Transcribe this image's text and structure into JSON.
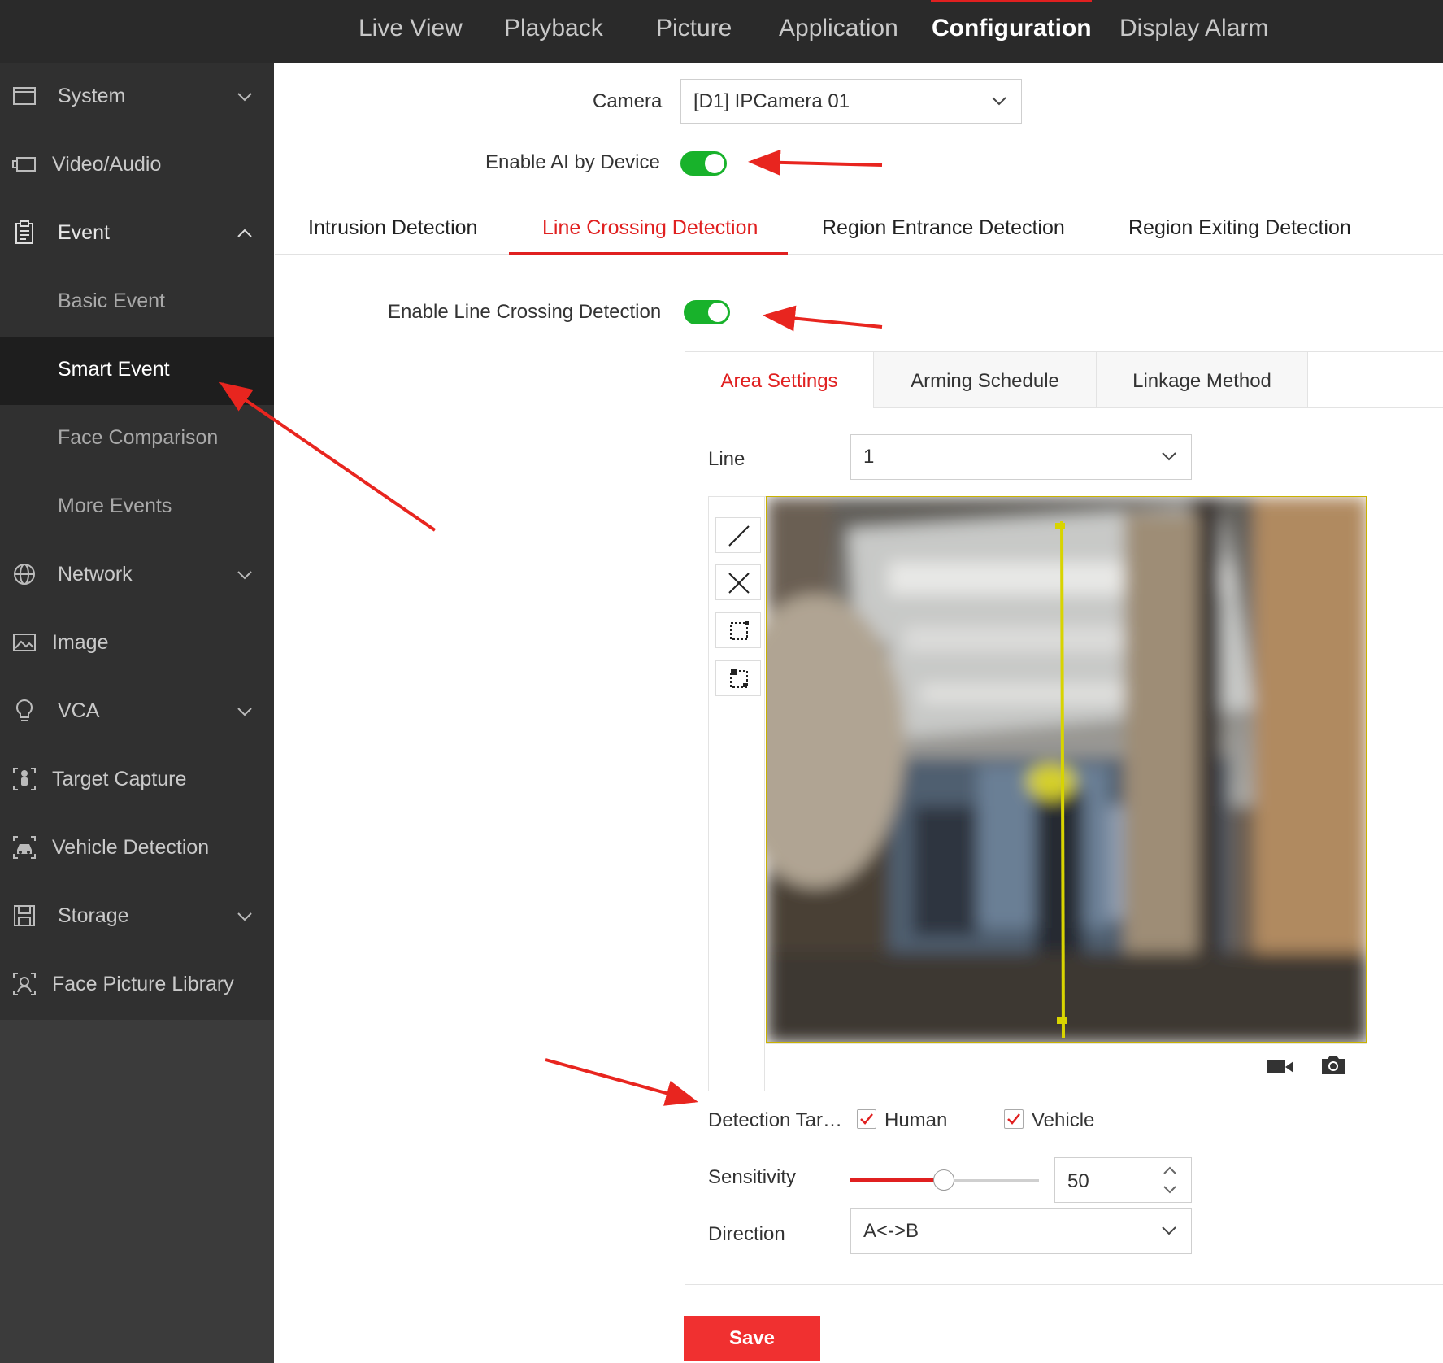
{
  "topnav": {
    "items": [
      {
        "label": "Live View"
      },
      {
        "label": "Playback"
      },
      {
        "label": "Picture"
      },
      {
        "label": "Application"
      },
      {
        "label": "Configuration"
      },
      {
        "label": "Display Alarm"
      }
    ],
    "active": "Configuration"
  },
  "sidebar": {
    "system": "System",
    "video_audio": "Video/Audio",
    "event": "Event",
    "basic_event": "Basic Event",
    "smart_event": "Smart Event",
    "face_comparison": "Face Comparison",
    "more_events": "More Events",
    "network": "Network",
    "image": "Image",
    "vca": "VCA",
    "target_capture": "Target Capture",
    "vehicle_detection": "Vehicle Detection",
    "storage": "Storage",
    "face_picture_library": "Face Picture Library",
    "selected": "Smart Event"
  },
  "main": {
    "camera_label": "Camera",
    "camera_value": "[D1] IPCamera 01",
    "enable_ai_label": "Enable AI by Device",
    "enable_ai_on": true,
    "tabs": [
      {
        "label": "Intrusion Detection"
      },
      {
        "label": "Line Crossing Detection"
      },
      {
        "label": "Region Entrance Detection"
      },
      {
        "label": "Region Exiting Detection"
      }
    ],
    "active_tab": "Line Crossing Detection",
    "enable_lcd_label": "Enable Line Crossing Detection",
    "enable_lcd_on": true,
    "subtabs": [
      {
        "label": "Area Settings"
      },
      {
        "label": "Arming Schedule"
      },
      {
        "label": "Linkage Method"
      }
    ],
    "active_subtab": "Area Settings",
    "line_label": "Line",
    "line_value": "1",
    "detection_target_label": "Detection Tar…",
    "targets": [
      {
        "label": "Human",
        "checked": true
      },
      {
        "label": "Vehicle",
        "checked": true
      }
    ],
    "sensitivity_label": "Sensitivity",
    "sensitivity_value": "50",
    "sensitivity_level": 50,
    "direction_label": "Direction",
    "direction_value": "A<->B",
    "save_label": "Save"
  },
  "colors": {
    "accent": "#e02020",
    "toggle_on": "#18b22b",
    "topbar_bg": "#2a2a2a",
    "sidebar_bg": "#303030",
    "detection_line": "#d8d400"
  },
  "icons": {
    "toolbar": [
      "draw-line-icon",
      "clear-icon",
      "stop-drawing-icon",
      "clear-all-icon"
    ],
    "video_bar": [
      "record-icon",
      "capture-icon"
    ]
  }
}
